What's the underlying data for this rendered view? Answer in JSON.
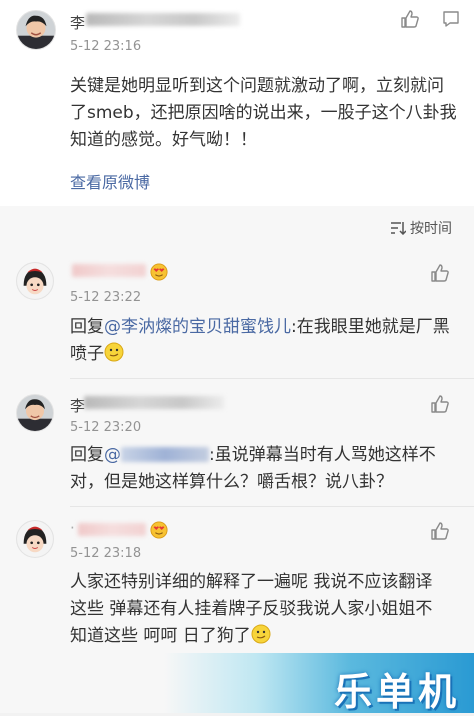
{
  "main_post": {
    "time": "5-12 23:16",
    "name_initial": "李",
    "text": "关键是她明显听到这个问题就激动了啊，立刻就问了smeb，还把原因啥的说出来，一股子这个八卦我知道的感觉。好气呦！！",
    "view_original": "查看原微博"
  },
  "sort": {
    "label": "按时间"
  },
  "comments": [
    {
      "time": "5-12 23:22",
      "reply_prefix": "回复",
      "mention": "@李汭燦的宝贝甜蜜饯儿",
      "text": ":在我眼里她就是厂黑 喷子"
    },
    {
      "name_initial": "李",
      "time": "5-12 23:20",
      "reply_prefix": "回复",
      "mention": "@",
      "text": ":虽说弹幕当时有人骂她这样不对，但是她这样算什么？嚼舌根？说八卦？"
    },
    {
      "time": "5-12 23:18",
      "text": "人家还特别详细的解释了一遍呢 我说不应该翻译这些 弹幕还有人挂着牌子反驳我说人家小姐姐不知道这些 呵呵 日了狗了"
    }
  ],
  "watermark": {
    "text": "乐单机"
  },
  "colors": {
    "link": "#4a69a3",
    "time": "#939393",
    "background": "#f2f2f2"
  }
}
